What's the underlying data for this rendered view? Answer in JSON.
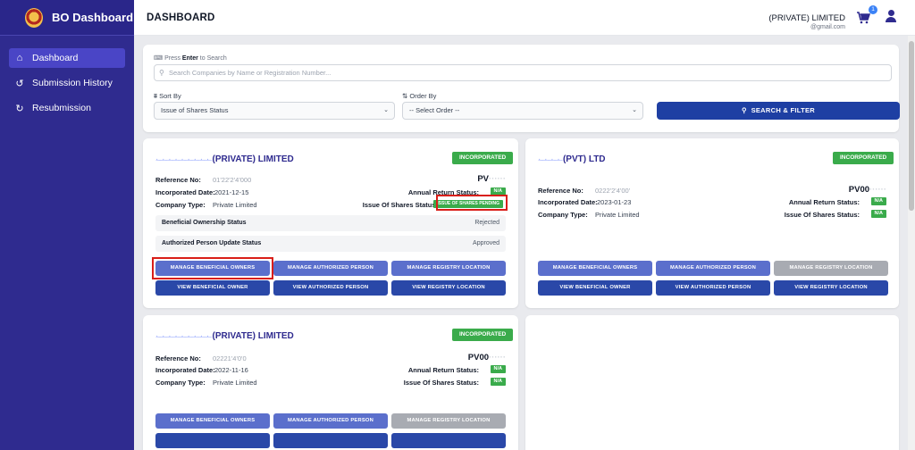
{
  "sidebar": {
    "brand": "BO Dashboard",
    "items": [
      {
        "label": "Dashboard",
        "icon": "home-icon"
      },
      {
        "label": "Submission History",
        "icon": "history-icon"
      },
      {
        "label": "Resubmission",
        "icon": "refresh-icon"
      }
    ]
  },
  "topbar": {
    "title": "DASHBOARD",
    "company": "(PRIVATE) LIMITED",
    "email": "@gmail.com",
    "cart_count": "1"
  },
  "search": {
    "hint_prefix": "Press",
    "hint_key": "Enter",
    "hint_suffix": "to Search",
    "placeholder": "Search Companies by Name or Registration Number...",
    "sort_label": "Sort By",
    "sort_value": "Issue of Shares Status",
    "order_label": "Order By",
    "order_value": "-- Select Order --",
    "button": "SEARCH & FILTER"
  },
  "labels": {
    "reference": "Reference No:",
    "incorporated": "Incorporated Date:",
    "company_type": "Company Type:",
    "annual_return": "Annual Return Status:",
    "issue_shares": "Issue Of Shares Status:",
    "beneficial_status": "Beneficial Ownership Status",
    "authorized_status": "Authorized Person Update Status",
    "incorporated_badge": "INCORPORATED",
    "manage_beneficial": "MANAGE BENEFICIAL OWNERS",
    "manage_authorized": "MANAGE AUTHORIZED PERSON",
    "manage_registry": "MANAGE REGISTRY LOCATION",
    "view_beneficial": "VIEW BENEFICIAL OWNER",
    "view_authorized": "VIEW AUTHORIZED PERSON",
    "view_registry": "VIEW REGISTRY LOCATION"
  },
  "cards": [
    {
      "title_redacted": "·̶ ̶·̶ ̶·̶ ̶·̶ ̶·̶ ̶·̶ ̶·̶ ̶·̶ ̶·̶",
      "title": "(PRIVATE) LIMITED",
      "reference": "01'22'2'4'000",
      "pv": "PV",
      "incorporated": "2021-12-15",
      "company_type": "Private Limited",
      "annual_return": "N/A",
      "issue_shares": "ISSUE OF SHARES PENDING",
      "beneficial_status": "Rejected",
      "authorized_status": "Approved"
    },
    {
      "title_redacted": "·̶ ̶·̶ ̶·̶ ̶·̶",
      "title": "(PVT) LTD",
      "reference": "0222'2'4'00'",
      "pv": "PV00",
      "incorporated": "2023-01-23",
      "company_type": "Private Limited",
      "annual_return": "N/A",
      "issue_shares": "N/A"
    },
    {
      "title_redacted": "·̶ ̶·̶ ̶·̶ ̶·̶ ̶·̶ ̶·̶ ̶·̶ ̶·̶ ̶·̶",
      "title": "(PRIVATE) LIMITED",
      "reference": "02221'4'0'0",
      "pv": "PV00",
      "incorporated": "2022-11-16",
      "company_type": "Private Limited",
      "annual_return": "N/A",
      "issue_shares": "N/A"
    }
  ]
}
